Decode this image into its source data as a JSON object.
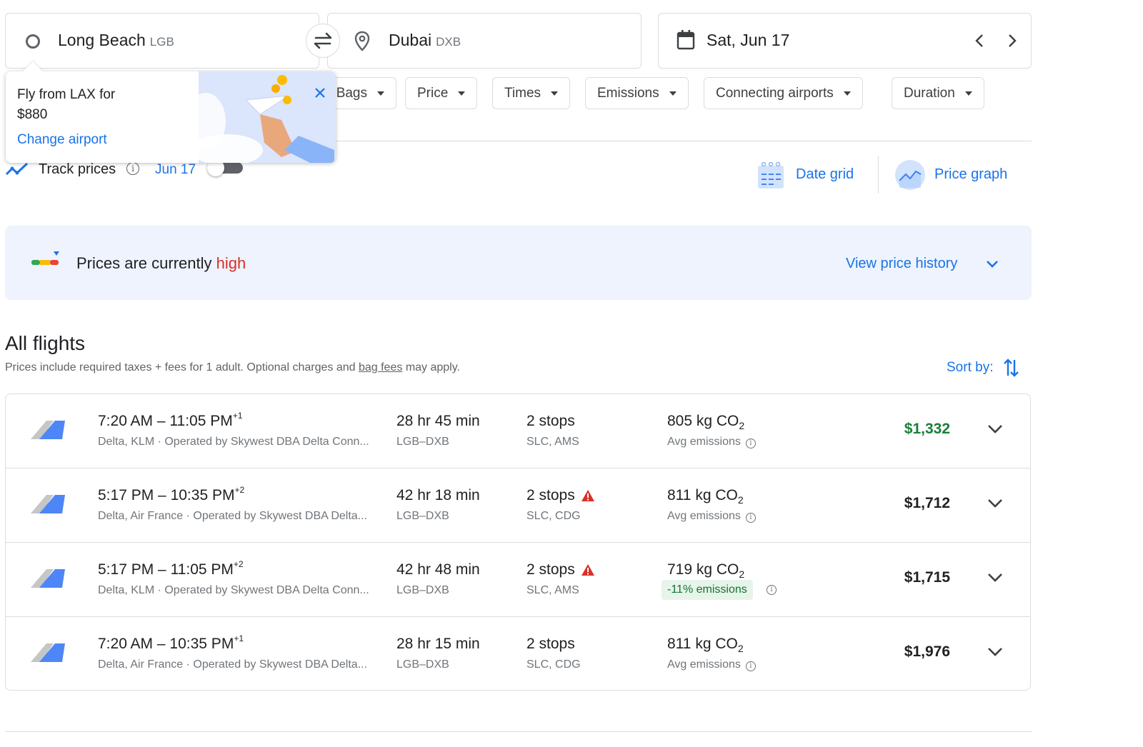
{
  "search": {
    "origin_city": "Long Beach",
    "origin_code": "LGB",
    "destination_city": "Dubai",
    "destination_code": "DXB",
    "date": "Sat, Jun 17"
  },
  "filters": {
    "bags": "Bags",
    "price": "Price",
    "times": "Times",
    "emissions": "Emissions",
    "connecting_airports": "Connecting airports",
    "duration": "Duration"
  },
  "popup": {
    "line1": "Fly from LAX for",
    "line2": "$880",
    "link": "Change airport"
  },
  "track": {
    "label": "Track prices",
    "date": "Jun 17",
    "enabled": false
  },
  "tools": {
    "date_grid": "Date grid",
    "price_graph": "Price graph"
  },
  "price_insight": {
    "prefix": "Prices are currently",
    "level": "high",
    "history_link": "View price history"
  },
  "results": {
    "heading": "All flights",
    "note_prefix": "Prices include required taxes + fees for 1 adult. Optional charges and",
    "note_link": "bag fees",
    "note_suffix": "may apply.",
    "sort_label": "Sort by:"
  },
  "flights": [
    {
      "depart": "7:20 AM",
      "arrive": "11:05 PM",
      "day_offset": "+1",
      "airlines": "Delta, KLM · Operated by Skywest DBA Delta Conn...",
      "duration": "28 hr 45 min",
      "route": "LGB–DXB",
      "stops": "2 stops",
      "stop_airports": "SLC, AMS",
      "warning": false,
      "co2": "805 kg CO",
      "co2_sub": "2",
      "emissions_note": "Avg emissions",
      "emissions_badge": false,
      "price": "$1,332",
      "price_color": "#188038"
    },
    {
      "depart": "5:17 PM",
      "arrive": "10:35 PM",
      "day_offset": "+2",
      "airlines": "Delta, Air France · Operated by Skywest DBA Delta...",
      "duration": "42 hr 18 min",
      "route": "LGB–DXB",
      "stops": "2 stops",
      "stop_airports": "SLC, CDG",
      "warning": true,
      "co2": "811 kg CO",
      "co2_sub": "2",
      "emissions_note": "Avg emissions",
      "emissions_badge": false,
      "price": "$1,712",
      "price_color": "#202124"
    },
    {
      "depart": "5:17 PM",
      "arrive": "11:05 PM",
      "day_offset": "+2",
      "airlines": "Delta, KLM · Operated by Skywest DBA Delta Conn...",
      "duration": "42 hr 48 min",
      "route": "LGB–DXB",
      "stops": "2 stops",
      "stop_airports": "SLC, AMS",
      "warning": true,
      "co2": "719 kg CO",
      "co2_sub": "2",
      "emissions_note": "-11% emissions",
      "emissions_badge": true,
      "price": "$1,715",
      "price_color": "#202124"
    },
    {
      "depart": "7:20 AM",
      "arrive": "10:35 PM",
      "day_offset": "+1",
      "airlines": "Delta, Air France · Operated by Skywest DBA Delta...",
      "duration": "28 hr 15 min",
      "route": "LGB–DXB",
      "stops": "2 stops",
      "stop_airports": "SLC, CDG",
      "warning": false,
      "co2": "811 kg CO",
      "co2_sub": "2",
      "emissions_note": "Avg emissions",
      "emissions_badge": false,
      "price": "$1,976",
      "price_color": "#202124"
    }
  ],
  "icons": {
    "origin": "circle-icon",
    "swap": "swap-icon",
    "destination": "location-pin-icon",
    "date": "calendar-icon",
    "prev": "chevron-left-icon",
    "next": "chevron-right-icon",
    "close": "close-icon",
    "track": "trend-line-icon",
    "info": "info-icon",
    "date_grid": "date-grid-icon",
    "price_graph": "price-graph-icon",
    "price_level": "price-level-icon",
    "expand": "chevron-down-icon",
    "sort": "sort-arrows-icon",
    "airline": "airline-logo-icon",
    "warning": "warning-icon"
  },
  "colors": {
    "accent": "#1a73e8",
    "high": "#d93025",
    "cheap_price": "#188038",
    "warning": "#d93025"
  }
}
